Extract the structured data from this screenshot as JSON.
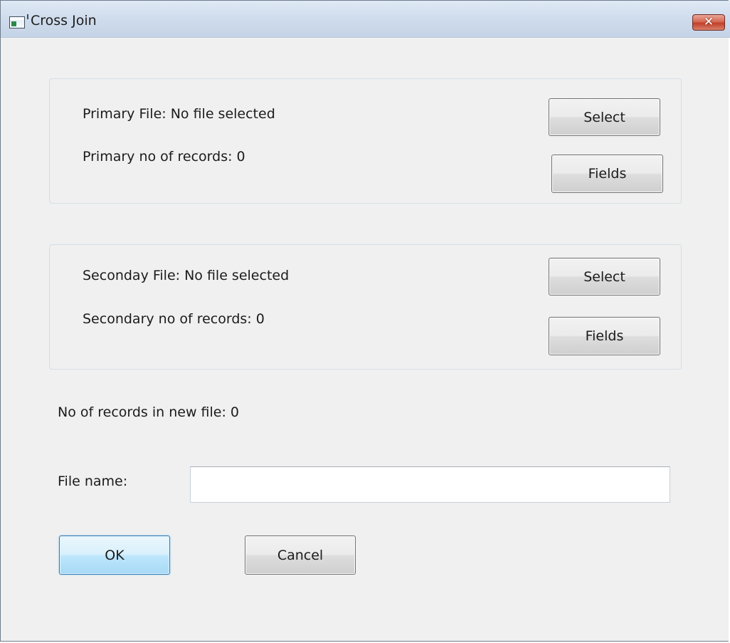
{
  "window": {
    "title": "Cross Join",
    "close_glyph": "✕"
  },
  "primary": {
    "file_label": "Primary File: No file selected",
    "records_label": "Primary no of records: 0",
    "select_label": "Select",
    "fields_label": "Fields"
  },
  "secondary": {
    "file_label": "Seconday File: No file selected",
    "records_label": "Secondary no of records: 0",
    "select_label": "Select",
    "fields_label": "Fields"
  },
  "result": {
    "records_label": "No of records in new file: 0",
    "file_name_label": "File name:",
    "file_name_value": "",
    "file_name_placeholder": ""
  },
  "actions": {
    "ok_label": "OK",
    "cancel_label": "Cancel"
  },
  "icons": {
    "app": "app-window-icon",
    "close": "close-icon"
  },
  "colors": {
    "dialog_background": "#f0f0f0",
    "close_button": "#c2402a",
    "default_button_border": "#3c7fb1"
  }
}
